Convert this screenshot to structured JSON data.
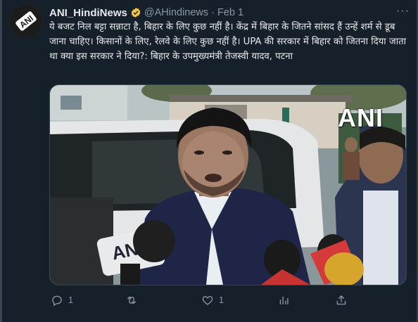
{
  "tweet": {
    "display_name": "ANI_HindiNews",
    "handle": "@AHindinews",
    "separator": "·",
    "date": "Feb 1",
    "more": "···",
    "text": "ये बजट निल बट्टा सन्नाटा है, बिहार के लिए कुछ नहीं है। केंद्र में बिहार के जितने सांसद हैं उन्हें शर्म से डूब जाना चाहिए। किसानों के लिए, रेलवे के लिए कुछ नहीं है। UPA की सरकार में बिहार को जितना दिया जाता था क्या इस सरकार ने दिया?: बिहार के उपमुख्यमंत्री तेजस्वी यादव, पटना",
    "avatar_logo_text": "ANI",
    "media_watermark": "ANI",
    "mic_logo_text": "ANI"
  },
  "actions": {
    "reply_count": "1",
    "retweet_count": "",
    "like_count": "1",
    "views_count": ""
  },
  "colors": {
    "background": "#15202b",
    "text": "#e7e9ea",
    "muted": "#8b98a5",
    "verified": "#f4c542"
  },
  "icons": [
    "ani-logo-icon",
    "verified-badge-icon",
    "more-icon",
    "reply-icon",
    "retweet-icon",
    "like-icon",
    "views-icon",
    "share-icon"
  ]
}
